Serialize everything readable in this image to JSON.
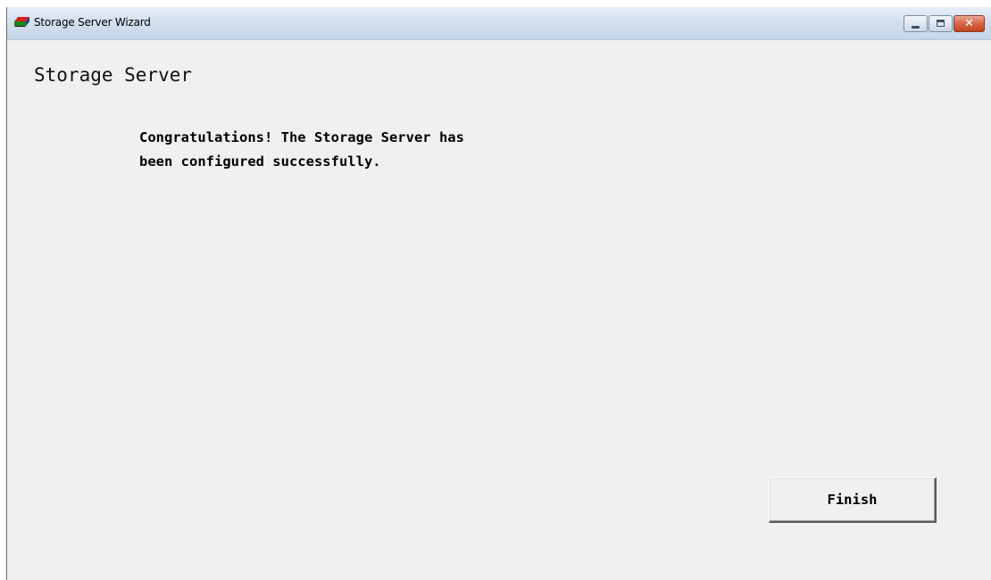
{
  "window": {
    "title": "Storage Server Wizard",
    "icon": "storage-server-icon",
    "controls": {
      "minimize": "minimize-icon",
      "maximize": "maximize-icon",
      "close_glyph": "✕"
    }
  },
  "page": {
    "heading": "Storage Server",
    "message_lines": [
      "Congratulations! The Storage Server has",
      "been configured successfully."
    ]
  },
  "buttons": {
    "finish": "Finish"
  },
  "colors": {
    "close_button": "#c4431f",
    "dialog_background": "#f0f0f0"
  }
}
